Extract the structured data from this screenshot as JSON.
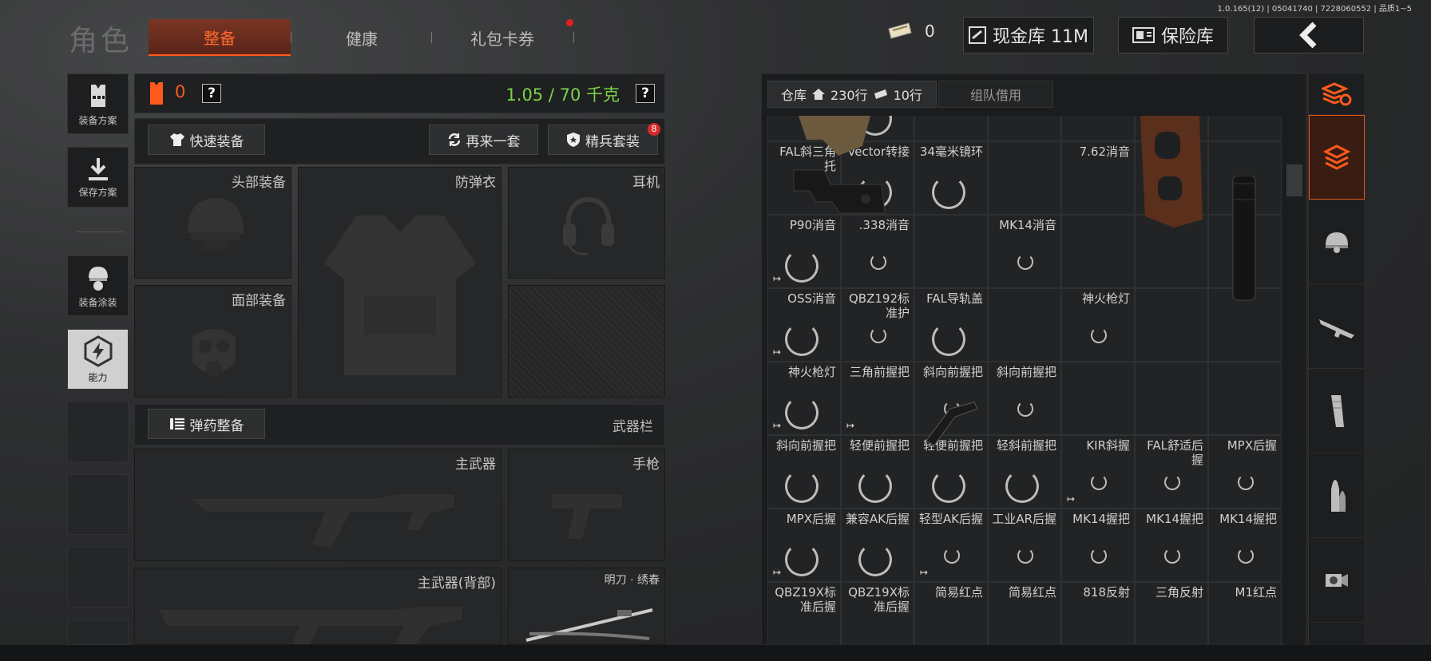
{
  "version": "1.0.165(12) | 05041740 | 7228060552 | 品质1~5",
  "title": "角色",
  "tabs": [
    {
      "label": "整备",
      "active": true
    },
    {
      "label": "健康"
    },
    {
      "label": "礼包卡券",
      "dot": true
    }
  ],
  "header": {
    "ticket_count": "0",
    "cash_label": "现金库 11M",
    "safe_label": "保险库"
  },
  "left_nav": [
    {
      "label": "装备方案",
      "icon": "vest-icon"
    },
    {
      "label": "保存方案",
      "icon": "download-icon"
    },
    {
      "label": "装备涂装",
      "icon": "helmet-paint-icon"
    },
    {
      "label": "能力",
      "icon": "ability-icon"
    }
  ],
  "loadout": {
    "armor_count": "0",
    "help": "?",
    "weight": "1.05 / 70 千克",
    "quick_equip": "快速装备",
    "again": "再来一套",
    "elite": "精兵套装",
    "elite_badge": "8",
    "slots": {
      "head": "头部装备",
      "vest": "防弹衣",
      "ear": "耳机",
      "face": "面部装备"
    },
    "ammo": "弹药整备",
    "weapon_bar": "武器栏",
    "weapons": {
      "primary": "主武器",
      "pistol": "手枪",
      "primary_back": "主武器(背部)",
      "knife": "明刀 · 绣春"
    }
  },
  "storage": {
    "tab": "仓库",
    "rows": "230行",
    "tickets": "10行",
    "team": "组队借用"
  },
  "items": [
    {
      "r": 0,
      "c": 0,
      "name": ""
    },
    {
      "r": 0,
      "c": 1,
      "name": "",
      "spin": "lg"
    },
    {
      "r": 0,
      "c": 2,
      "name": ""
    },
    {
      "r": 0,
      "c": 4,
      "name": ""
    },
    {
      "r": 1,
      "c": 0,
      "name": "FAL斜三角托"
    },
    {
      "r": 1,
      "c": 1,
      "name": "Vector转接",
      "spin": "lg"
    },
    {
      "r": 1,
      "c": 2,
      "name": "34毫米镜环",
      "spin": "lg"
    },
    {
      "r": 1,
      "c": 4,
      "name": "7.62消音"
    },
    {
      "r": 2,
      "c": 0,
      "name": "P90消音",
      "spin": "lg",
      "exit": true
    },
    {
      "r": 2,
      "c": 1,
      "name": ".338消音",
      "spin": "sm"
    },
    {
      "r": 2,
      "c": 3,
      "name": "MK14消音",
      "spin": "sm"
    },
    {
      "r": 3,
      "c": 0,
      "name": "OSS消音",
      "spin": "lg",
      "exit": true
    },
    {
      "r": 3,
      "c": 1,
      "name": "QBZ192标准护",
      "spin": "sm"
    },
    {
      "r": 3,
      "c": 2,
      "name": "FAL导轨盖",
      "spin": "lg"
    },
    {
      "r": 3,
      "c": 4,
      "name": "神火枪灯",
      "spin": "sm"
    },
    {
      "r": 4,
      "c": 0,
      "name": "神火枪灯",
      "spin": "lg",
      "exit": true
    },
    {
      "r": 4,
      "c": 1,
      "name": "三角前握把",
      "exit": true
    },
    {
      "r": 4,
      "c": 2,
      "name": "斜向前握把",
      "spin": "sm"
    },
    {
      "r": 4,
      "c": 3,
      "name": "斜向前握把",
      "spin": "sm"
    },
    {
      "r": 5,
      "c": 0,
      "name": "斜向前握把",
      "spin": "lg"
    },
    {
      "r": 5,
      "c": 1,
      "name": "轻便前握把",
      "spin": "lg"
    },
    {
      "r": 5,
      "c": 2,
      "name": "轻便前握把",
      "spin": "lg"
    },
    {
      "r": 5,
      "c": 3,
      "name": "轻斜前握把",
      "spin": "lg"
    },
    {
      "r": 5,
      "c": 4,
      "name": "KIR斜握",
      "spin": "sm",
      "exit": true
    },
    {
      "r": 5,
      "c": 5,
      "name": "FAL舒适后握",
      "spin": "sm"
    },
    {
      "r": 5,
      "c": 6,
      "name": "MPX后握",
      "spin": "sm"
    },
    {
      "r": 6,
      "c": 0,
      "name": "MPX后握",
      "spin": "lg",
      "exit": true
    },
    {
      "r": 6,
      "c": 1,
      "name": "兼容AK后握",
      "spin": "lg"
    },
    {
      "r": 6,
      "c": 2,
      "name": "轻型AK后握",
      "spin": "sm",
      "exit": true
    },
    {
      "r": 6,
      "c": 3,
      "name": "工业AR后握",
      "spin": "sm"
    },
    {
      "r": 6,
      "c": 4,
      "name": "MK14握把",
      "spin": "sm"
    },
    {
      "r": 6,
      "c": 5,
      "name": "MK14握把",
      "spin": "sm"
    },
    {
      "r": 6,
      "c": 6,
      "name": "MK14握把",
      "spin": "sm"
    },
    {
      "r": 7,
      "c": 0,
      "name": "QBZ19X标准后握"
    },
    {
      "r": 7,
      "c": 1,
      "name": "QBZ19X标准后握"
    },
    {
      "r": 7,
      "c": 2,
      "name": "简易红点"
    },
    {
      "r": 7,
      "c": 3,
      "name": "简易红点"
    },
    {
      "r": 7,
      "c": 4,
      "name": "818反射"
    },
    {
      "r": 7,
      "c": 5,
      "name": "三角反射"
    },
    {
      "r": 7,
      "c": 6,
      "name": "M1红点"
    }
  ],
  "right_icons": [
    "stack-refresh-icon",
    "stack-icon",
    "helmet-icon",
    "rifle-icon",
    "magazine-icon",
    "bullet-icon",
    "scope-icon"
  ],
  "colors": {
    "accent": "#ff5a1e",
    "weight": "#7bd34a"
  }
}
